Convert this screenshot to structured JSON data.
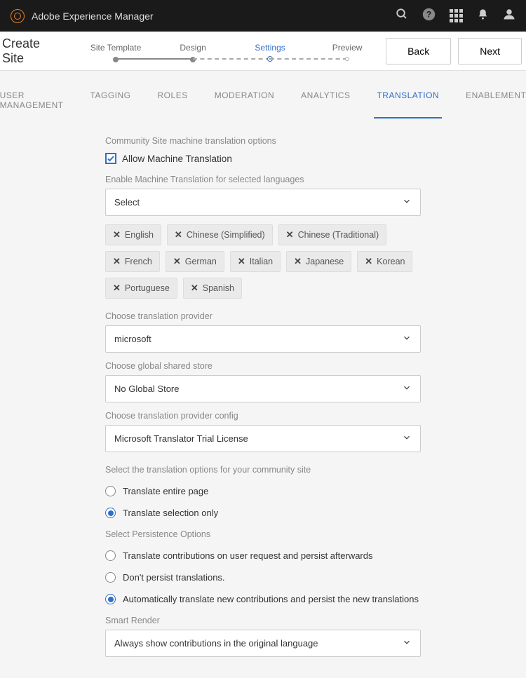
{
  "topbar": {
    "title": "Adobe Experience Manager"
  },
  "page": {
    "title": "Create Site"
  },
  "steps": [
    {
      "label": "Site Template"
    },
    {
      "label": "Design"
    },
    {
      "label": "Settings"
    },
    {
      "label": "Preview"
    }
  ],
  "buttons": {
    "back": "Back",
    "next": "Next"
  },
  "tabs": [
    "USER MANAGEMENT",
    "TAGGING",
    "ROLES",
    "MODERATION",
    "ANALYTICS",
    "TRANSLATION",
    "ENABLEMENT"
  ],
  "form": {
    "section_title": "Community Site machine translation options",
    "allow_label": "Allow Machine Translation",
    "languages_label": "Enable Machine Translation for selected languages",
    "languages_select": "Select",
    "chips": [
      "English",
      "Chinese (Simplified)",
      "Chinese (Traditional)",
      "French",
      "German",
      "Italian",
      "Japanese",
      "Korean",
      "Portuguese",
      "Spanish"
    ],
    "provider_label": "Choose translation provider",
    "provider_value": "microsoft",
    "store_label": "Choose global shared store",
    "store_value": "No Global Store",
    "config_label": "Choose translation provider config",
    "config_value": "Microsoft Translator Trial License",
    "options_label": "Select the translation options for your community site",
    "opt_entire": "Translate entire page",
    "opt_selection": "Translate selection only",
    "persist_label": "Select Persistence Options",
    "persist_request": "Translate contributions on user request and persist afterwards",
    "persist_none": "Don't persist translations.",
    "persist_auto": "Automatically translate new contributions and persist the new translations",
    "render_label": "Smart Render",
    "render_value": "Always show contributions in the original language"
  }
}
